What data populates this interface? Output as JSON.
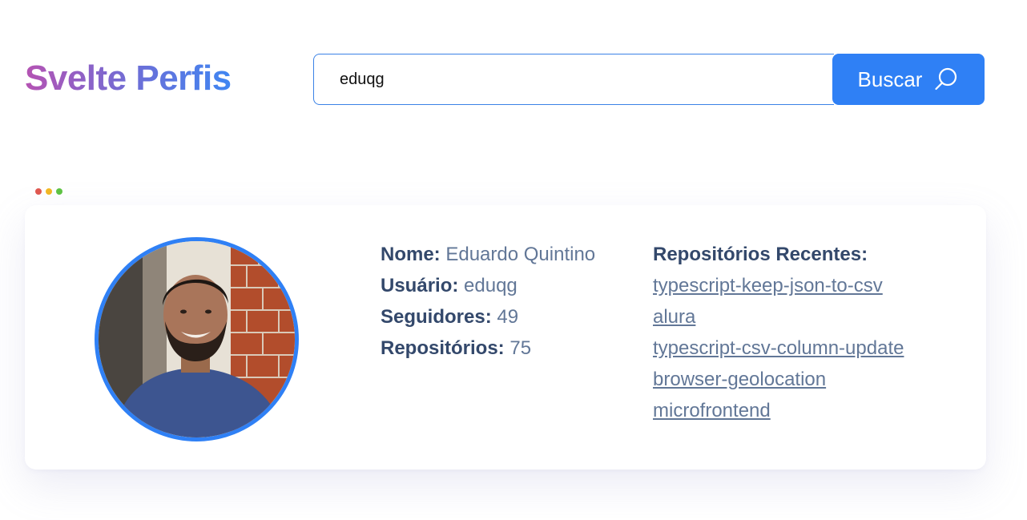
{
  "header": {
    "logo": "Svelte Perfis"
  },
  "search": {
    "value": "eduqg",
    "button_label": "Buscar"
  },
  "window_dots": [
    "#e0584f",
    "#f2b824",
    "#5fc443"
  ],
  "profile": {
    "name_label": "Nome:",
    "name": "Eduardo Quintino",
    "user_label": "Usuário:",
    "user": "eduqg",
    "followers_label": "Seguidores:",
    "followers": "49",
    "repos_label": "Repositórios:",
    "repos": "75"
  },
  "recent": {
    "title": "Repositórios Recentes:",
    "items": [
      "typescript-keep-json-to-csv",
      "alura",
      "typescript-csv-column-update",
      "browser-geolocation",
      "microfrontend"
    ]
  },
  "colors": {
    "accent": "#2f80f5",
    "label": "#33486b",
    "value": "#627797"
  }
}
